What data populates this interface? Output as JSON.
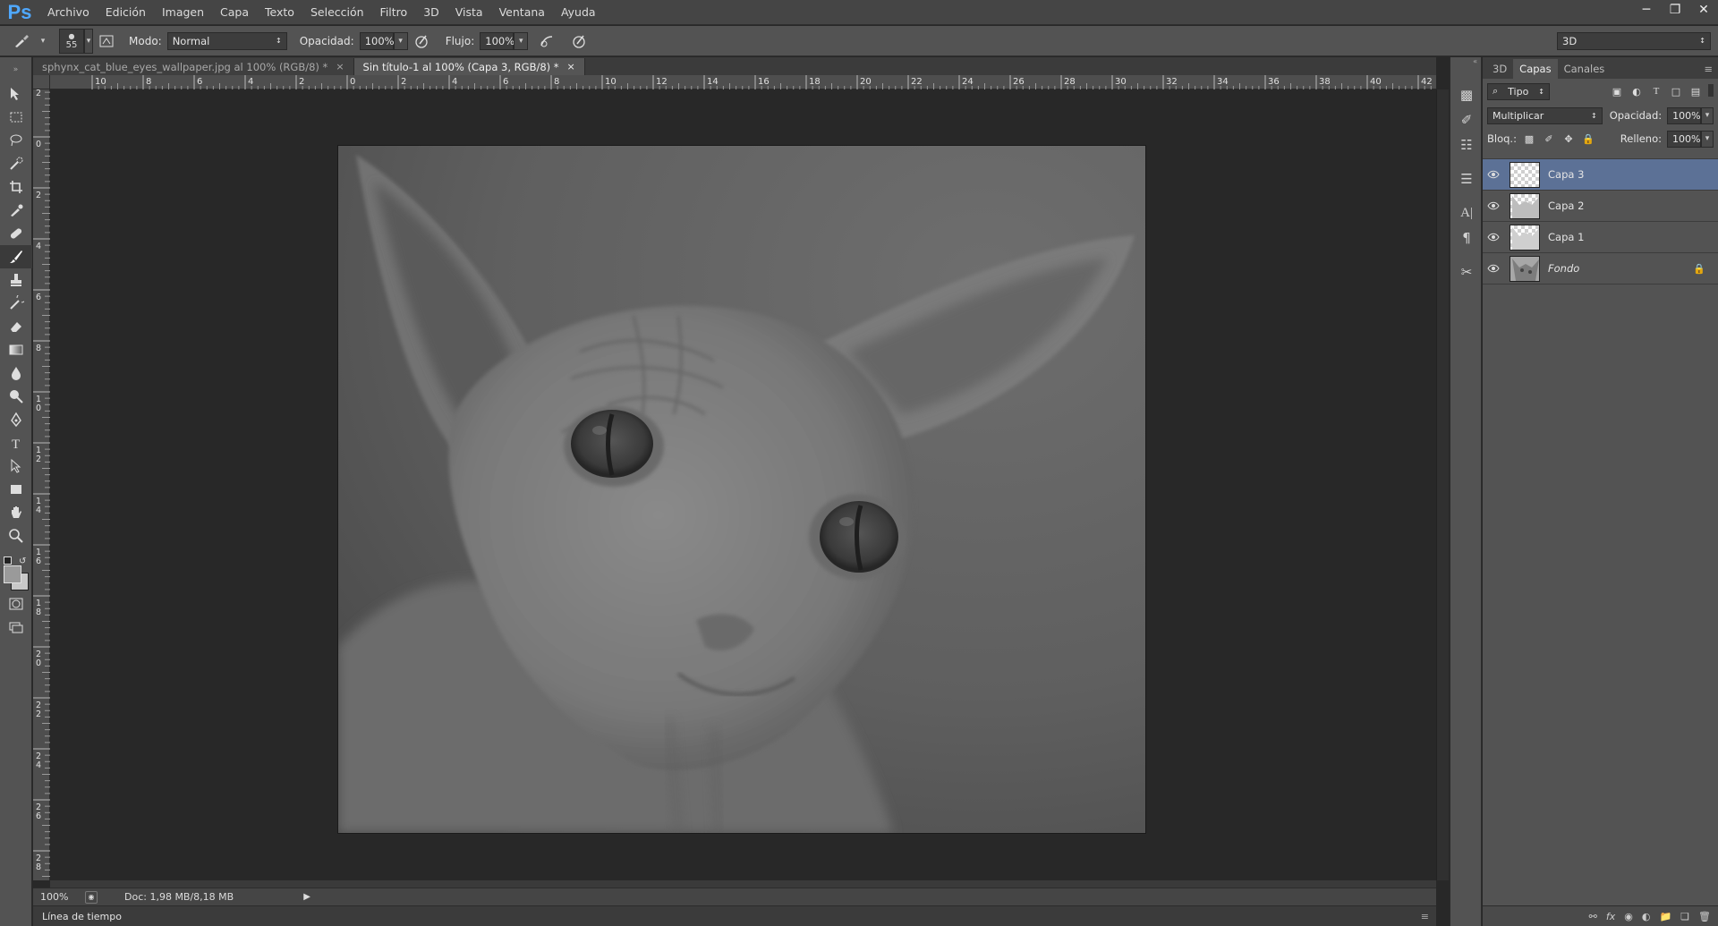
{
  "app": {
    "logo": "Ps"
  },
  "menu": [
    "Archivo",
    "Edición",
    "Imagen",
    "Capa",
    "Texto",
    "Selección",
    "Filtro",
    "3D",
    "Vista",
    "Ventana",
    "Ayuda"
  ],
  "options_bar": {
    "brush_size": "55",
    "mode_label": "Modo:",
    "mode_value": "Normal",
    "opacity_label": "Opacidad:",
    "opacity_value": "100%",
    "flow_label": "Flujo:",
    "flow_value": "100%",
    "workspace": "3D"
  },
  "tabs": [
    {
      "label": "sphynx_cat_blue_eyes_wallpaper.jpg al 100% (RGB/8) *",
      "active": false
    },
    {
      "label": "Sin título-1 al 100% (Capa 3, RGB/8) *",
      "active": true
    }
  ],
  "ruler_top_labels": [
    "10",
    "8",
    "6",
    "4",
    "2",
    "0",
    "2",
    "4",
    "6",
    "8",
    "10",
    "12",
    "14",
    "16",
    "18",
    "20",
    "22",
    "24",
    "26",
    "28",
    "30",
    "32",
    "34",
    "36",
    "38",
    "40",
    "42"
  ],
  "ruler_left_labels": [
    "2",
    "0",
    "2",
    "4",
    "6",
    "8",
    "10",
    "12",
    "14",
    "16",
    "18",
    "20",
    "22",
    "24",
    "26",
    "28"
  ],
  "status": {
    "zoom": "100%",
    "doc": "Doc: 1,98 MB/8,18 MB"
  },
  "timeline_label": "Línea de tiempo",
  "layers_panel": {
    "tabs": [
      "3D",
      "Capas",
      "Canales"
    ],
    "active_tab": "Capas",
    "filter_kind": "Tipo",
    "blend_mode": "Multiplicar",
    "opacity_label": "Opacidad:",
    "opacity_value": "100%",
    "lock_label": "Bloq.:",
    "fill_label": "Relleno:",
    "fill_value": "100%",
    "layers": [
      {
        "name": "Capa 3",
        "selected": true,
        "visible": true
      },
      {
        "name": "Capa 2",
        "selected": false,
        "visible": true
      },
      {
        "name": "Capa 1",
        "selected": false,
        "visible": true
      },
      {
        "name": "Fondo",
        "selected": false,
        "visible": true,
        "locked": true
      }
    ]
  },
  "colors": {
    "accent_selected": "#5c7196",
    "ps_blue": "#4fa8ff"
  }
}
